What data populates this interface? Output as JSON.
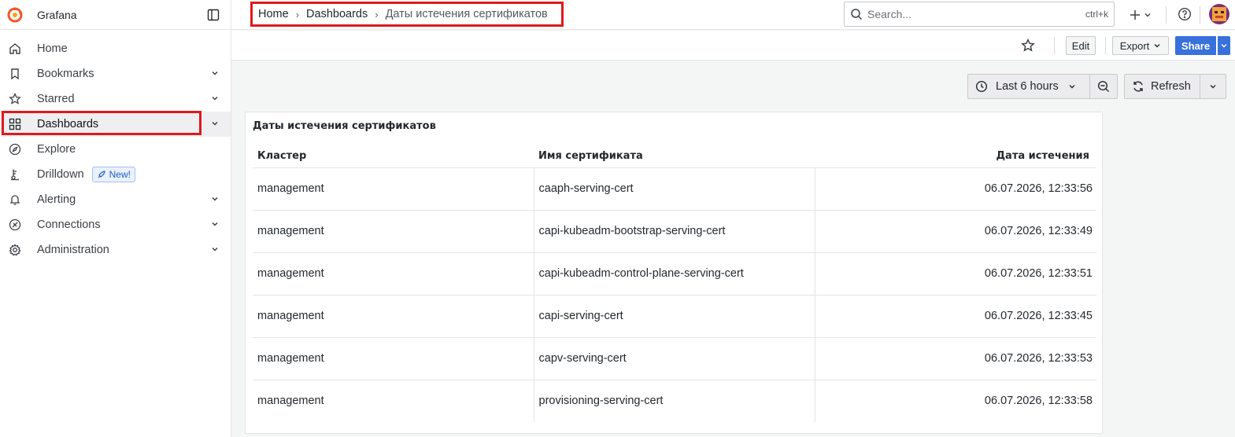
{
  "app": {
    "name": "Grafana"
  },
  "sidebar": {
    "items": [
      {
        "label": "Home",
        "icon": "home-icon",
        "chevron": false
      },
      {
        "label": "Bookmarks",
        "icon": "bookmark-icon",
        "chevron": true
      },
      {
        "label": "Starred",
        "icon": "star-icon",
        "chevron": true
      },
      {
        "label": "Dashboards",
        "icon": "dashboards-icon",
        "chevron": true,
        "active": true
      },
      {
        "label": "Explore",
        "icon": "compass-icon",
        "chevron": false
      },
      {
        "label": "Drilldown",
        "icon": "drilldown-icon",
        "chevron": false,
        "badge": "New!"
      },
      {
        "label": "Alerting",
        "icon": "bell-icon",
        "chevron": true
      },
      {
        "label": "Connections",
        "icon": "connections-icon",
        "chevron": true
      },
      {
        "label": "Administration",
        "icon": "gear-icon",
        "chevron": true
      }
    ]
  },
  "breadcrumb": {
    "items": [
      "Home",
      "Dashboards"
    ],
    "current": "Даты истечения сертификатов"
  },
  "search": {
    "placeholder": "Search...",
    "shortcut": "ctrl+k"
  },
  "toolbar": {
    "edit_label": "Edit",
    "export_label": "Export",
    "share_label": "Share"
  },
  "controls": {
    "time_range": "Last 6 hours",
    "refresh_label": "Refresh"
  },
  "panel": {
    "title": "Даты истечения сертификатов",
    "columns": [
      "Кластер",
      "Имя сертификата",
      "Дата истечения"
    ],
    "rows": [
      [
        "management",
        "caaph-serving-cert",
        "06.07.2026, 12:33:56"
      ],
      [
        "management",
        "capi-kubeadm-bootstrap-serving-cert",
        "06.07.2026, 12:33:49"
      ],
      [
        "management",
        "capi-kubeadm-control-plane-serving-cert",
        "06.07.2026, 12:33:51"
      ],
      [
        "management",
        "capi-serving-cert",
        "06.07.2026, 12:33:45"
      ],
      [
        "management",
        "capv-serving-cert",
        "06.07.2026, 12:33:53"
      ],
      [
        "management",
        "provisioning-serving-cert",
        "06.07.2026, 12:33:58"
      ]
    ]
  },
  "colors": {
    "highlight": "#e0191a",
    "primary": "#3871dc",
    "grafana_orange": "#f05a28"
  }
}
